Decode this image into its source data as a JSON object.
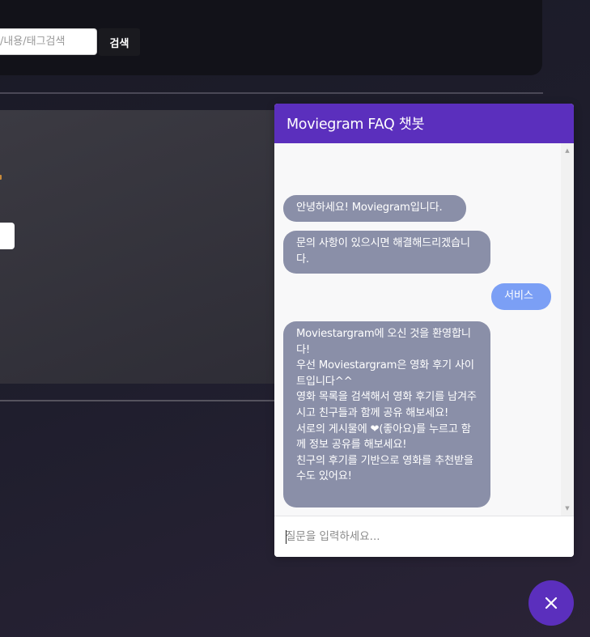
{
  "search": {
    "placeholder": "목/내용/태그검색",
    "button_label": "검색"
  },
  "chat": {
    "title": "Moviegram FAQ 챗봇",
    "messages": [
      {
        "role": "bot",
        "text": "안녕하세요! Moviegram입니다."
      },
      {
        "role": "bot",
        "text": "문의 사항이 있으시면 해결해드리겠습니다."
      },
      {
        "role": "user",
        "text": "서비스"
      },
      {
        "role": "bot",
        "text": "Moviestargram에 오신 것을 환영합니다!\n우선 Moviestargram은 영화 후기 사이트입니다^^\n영화 목록을 검색해서 영화 후기를 남겨주시고 친구들과 함께 공유 해보세요!\n서로의 게시물에 ❤(좋아요)를 누르고 함께 정보 공유를 해보세요!\n친구의 후기를 기반으로 영화를 추천받을 수도 있어요!"
      }
    ],
    "input_placeholder": "질문을 입력하세요...",
    "close_icon": "close-icon",
    "colors": {
      "header": "#5b2fbd",
      "bot_bubble": "#8a8fa8",
      "user_bubble": "#7b9ff5"
    }
  }
}
